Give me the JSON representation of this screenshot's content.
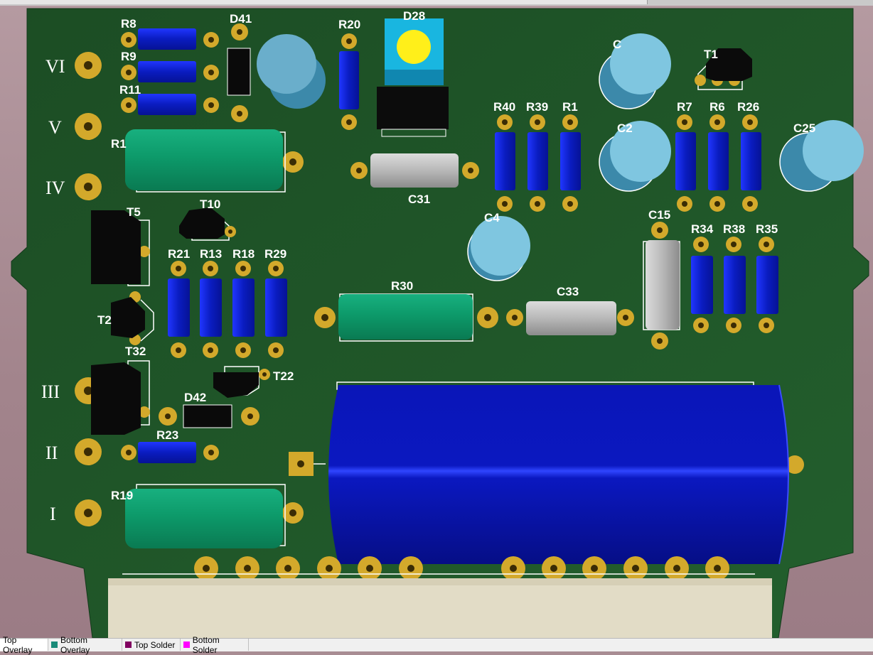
{
  "connector_labels": [
    "VI",
    "V",
    "IV",
    "III",
    "II",
    "I"
  ],
  "designators": {
    "R8": "R8",
    "R9": "R9",
    "R11": "R11",
    "D41": "D41",
    "R20": "R20",
    "D28": "D28",
    "R1_left": "R1",
    "R40": "R40",
    "R39": "R39",
    "R1": "R1",
    "R7": "R7",
    "R6": "R6",
    "R26": "R26",
    "C25": "C25",
    "T1": "T1",
    "C_top": "C",
    "C2": "C2",
    "C31": "C31",
    "T5": "T5",
    "T10": "T10",
    "R21": "R21",
    "R13": "R13",
    "R18": "R18",
    "R29": "R29",
    "C4": "C4",
    "C15": "C15",
    "R34": "R34",
    "R38": "R38",
    "R35": "R35",
    "R30": "R30",
    "C33": "C33",
    "T2": "T2",
    "T32": "T32",
    "T22": "T22",
    "D42": "D42",
    "R23": "R23",
    "R19": "R19"
  },
  "layer_tabs": [
    {
      "label": "Top Overlay",
      "color": "#ffffff",
      "active": true
    },
    {
      "label": "Bottom Overlay",
      "color": "#1a8a78",
      "active": false
    },
    {
      "label": "Top Solder",
      "color": "#800060",
      "active": false
    },
    {
      "label": "Bottom Solder",
      "color": "#ff00ff",
      "active": false
    }
  ],
  "colors": {
    "board": "#1f5a2a",
    "pad": "#d3a92b",
    "resistor": "#0b1fc8",
    "film_resistor": "#0d9a6a",
    "electrolytic": "#7fc6e0",
    "big_cap": "#0a14a8",
    "connector": "#e2dcc6"
  }
}
